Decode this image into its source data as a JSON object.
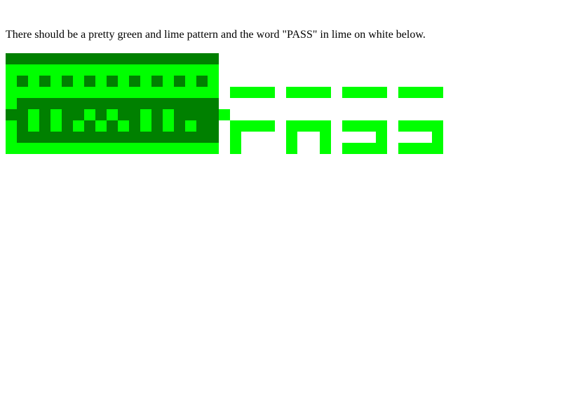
{
  "instruction_text": "There should be a pretty green and lime pattern and the word \"PASS\" in lime on white below.",
  "colors": {
    "green": "#008000",
    "lime": "#00ff00",
    "background": "#ffffff",
    "text": "#000000"
  }
}
